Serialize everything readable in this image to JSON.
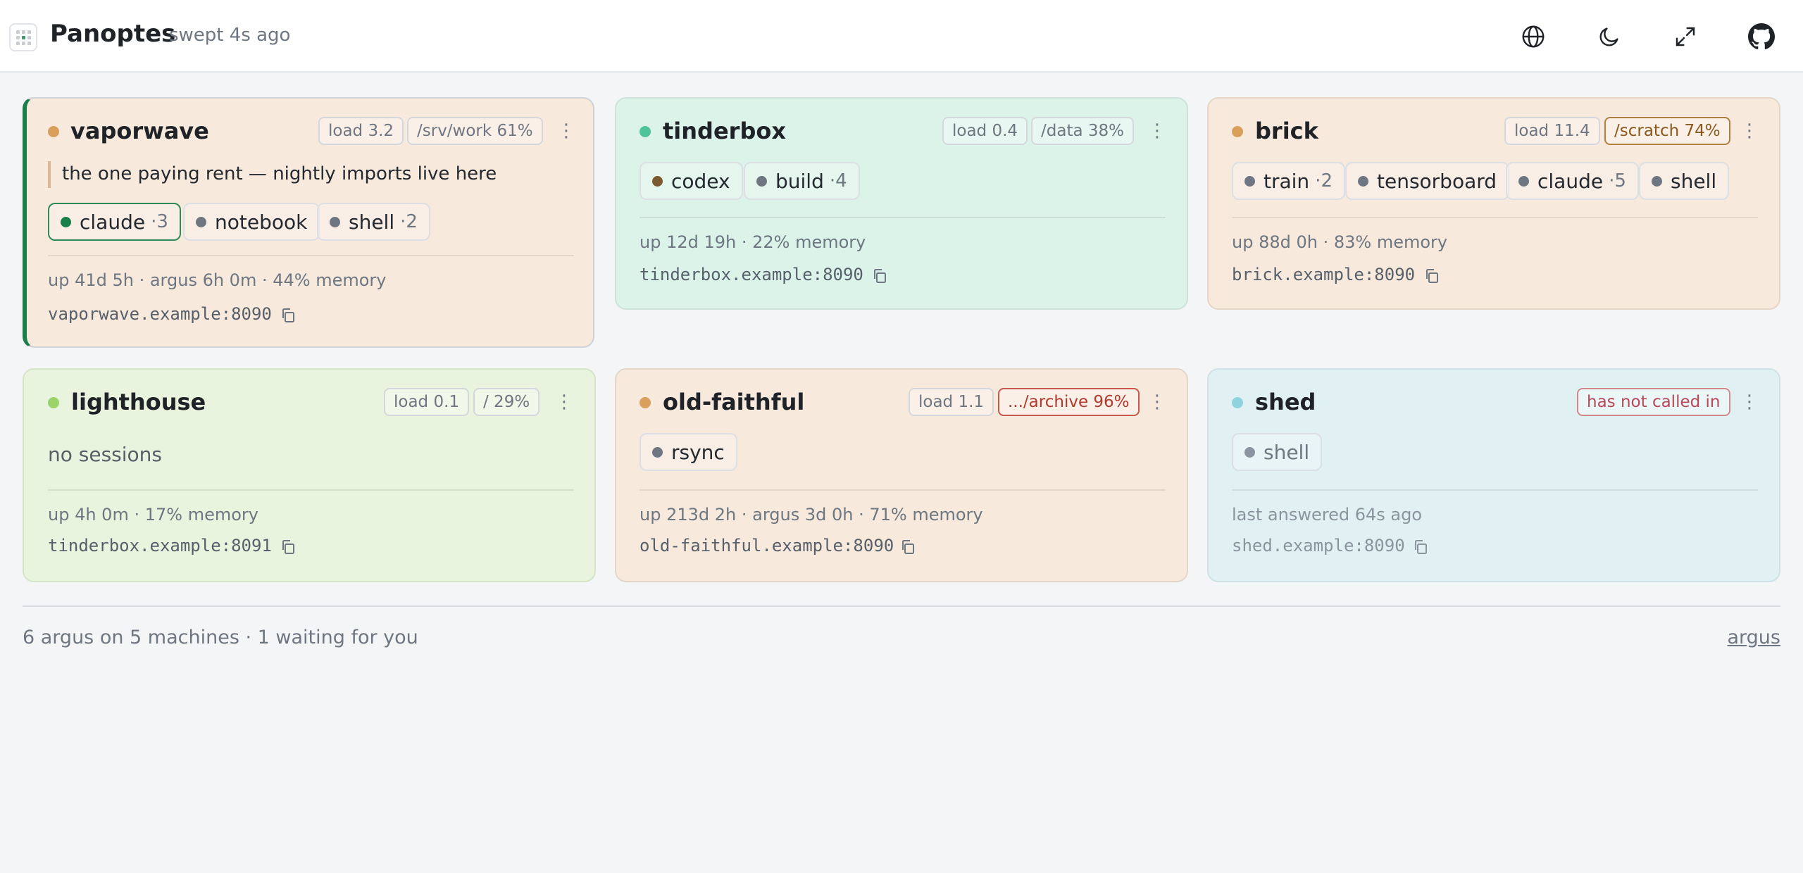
{
  "header": {
    "title": "Panoptes",
    "swept": "swept 4s ago",
    "buttons": [
      "globe-icon",
      "moon-icon",
      "expand-icon",
      "github-icon"
    ]
  },
  "machines": [
    {
      "name": "vaporwave",
      "status_color": "#d9a05b",
      "bg": "#f7e9dc",
      "load": "load 3.2",
      "disk": "/srv/work 61%",
      "note": "the one paying rent — nightly imports live here",
      "sessions": [
        {
          "label": "claude",
          "count": "·3",
          "dot": "#1a7f4b",
          "active": true
        },
        {
          "label": "notebook",
          "count": "",
          "dot": "#6e7781"
        },
        {
          "label": "shell",
          "count": "·2",
          "dot": "#6e7781"
        }
      ],
      "meta": "up 41d 5h · argus 6h 0m · 44% memory",
      "address": "vaporwave.example:8090"
    },
    {
      "name": "tinderbox",
      "status_color": "#4fc39a",
      "bg": "#dcf3ea",
      "load": "load 0.4",
      "disk": "/data 38%",
      "sessions": [
        {
          "label": "codex",
          "count": "",
          "dot": "#7a5a2e"
        },
        {
          "label": "build",
          "count": "·4",
          "dot": "#6e7781"
        }
      ],
      "meta": "up 12d 19h · 22% memory",
      "address": "tinderbox.example:8090"
    },
    {
      "name": "brick",
      "status_color": "#d9a05b",
      "bg": "#f7e9dc",
      "load": "load 11.4",
      "disk": "/scratch 74%",
      "sessions": [
        {
          "label": "train",
          "count": "·2",
          "dot": "#6e7781"
        },
        {
          "label": "tensorboard",
          "count": "",
          "dot": "#6e7781"
        },
        {
          "label": "claude",
          "count": "·5",
          "dot": "#6e7781"
        },
        {
          "label": "shell",
          "count": "",
          "dot": "#6e7781"
        }
      ],
      "meta": "up 88d 0h · 83% memory",
      "address": "brick.example:8090"
    },
    {
      "name": "lighthouse",
      "status_color": "#9ad46a",
      "bg": "#e8f4de",
      "load": "load 0.1",
      "disk": "/ 29%",
      "empty": "no sessions",
      "meta": "up 4h 0m · 17% memory",
      "address": "tinderbox.example:8091"
    },
    {
      "name": "old-faithful",
      "status_color": "#d9a05b",
      "bg": "#f7e9dc",
      "load": "load 1.1",
      "disk": ".../archive 96%",
      "sessions": [
        {
          "label": "rsync",
          "count": "",
          "dot": "#6e7781"
        }
      ],
      "meta": "up 213d 2h · argus 3d 0h · 71% memory",
      "address": "old-faithful.example:8090"
    },
    {
      "name": "shed",
      "status_color": "#8fd3e0",
      "bg": "#e1f1f3",
      "badge": "has not called in",
      "sessions": [
        {
          "label": "shell",
          "count": "",
          "dot": "#8b949e"
        }
      ],
      "meta": "last answered 64s ago",
      "address": "shed.example:8090"
    }
  ],
  "footer": {
    "summary": "6 argus on 5 machines · 1 waiting for you",
    "link": "argus"
  }
}
